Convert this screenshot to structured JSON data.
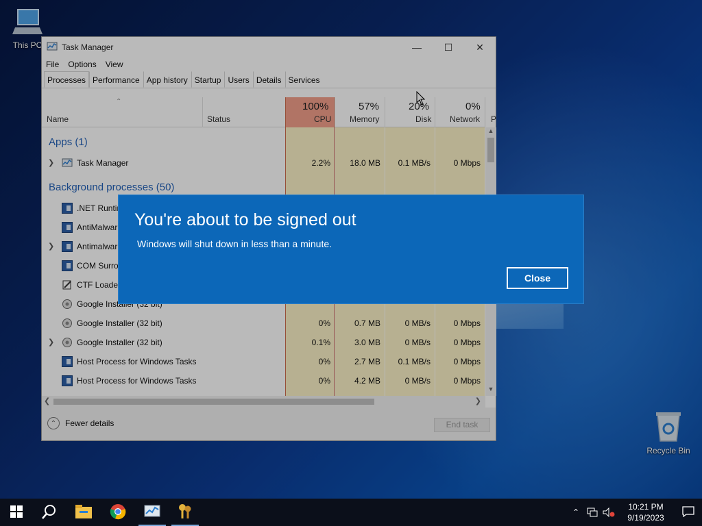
{
  "desktop": {
    "icons": [
      {
        "label": "This PC",
        "icon": "computer-icon"
      },
      {
        "label": "Recycle Bin",
        "icon": "recycle-bin-icon"
      }
    ]
  },
  "task_manager": {
    "title": "Task Manager",
    "menu": [
      "File",
      "Options",
      "View"
    ],
    "tabs": [
      "Processes",
      "Performance",
      "App history",
      "Startup",
      "Users",
      "Details",
      "Services"
    ],
    "active_tab": "Processes",
    "columns": {
      "name": "Name",
      "status": "Status",
      "cpu": {
        "pct": "100%",
        "label": "CPU"
      },
      "memory": {
        "pct": "57%",
        "label": "Memory"
      },
      "disk": {
        "pct": "20%",
        "label": "Disk"
      },
      "network": {
        "pct": "0%",
        "label": "Network"
      },
      "more": "P"
    },
    "groups": {
      "apps": "Apps (1)",
      "background": "Background processes (50)"
    },
    "rows": [
      {
        "name": "Task Manager",
        "expand": true,
        "cpu": "2.2%",
        "memory": "18.0 MB",
        "disk": "0.1 MB/s",
        "network": "0 Mbps"
      },
      {
        "name": ".NET Runtim",
        "expand": false,
        "cpu": "",
        "memory": "",
        "disk": "",
        "network": ""
      },
      {
        "name": "AntiMalwar",
        "expand": false,
        "cpu": "",
        "memory": "",
        "disk": "",
        "network": ""
      },
      {
        "name": "Antimalwar",
        "expand": true,
        "cpu": "",
        "memory": "",
        "disk": "",
        "network": ""
      },
      {
        "name": "COM Surroc",
        "expand": false,
        "cpu": "",
        "memory": "",
        "disk": "",
        "network": ""
      },
      {
        "name": "CTF Loader",
        "expand": false,
        "cpu": "",
        "memory": "",
        "disk": "",
        "network": ""
      },
      {
        "name": "Google Installer (32 bit)",
        "expand": false,
        "cpu": "",
        "memory": "",
        "disk": "",
        "network": ""
      },
      {
        "name": "Google Installer (32 bit)",
        "expand": false,
        "cpu": "0%",
        "memory": "0.7 MB",
        "disk": "0 MB/s",
        "network": "0 Mbps"
      },
      {
        "name": "Google Installer (32 bit)",
        "expand": true,
        "cpu": "0.1%",
        "memory": "3.0 MB",
        "disk": "0 MB/s",
        "network": "0 Mbps"
      },
      {
        "name": "Host Process for Windows Tasks",
        "expand": false,
        "cpu": "0%",
        "memory": "2.7 MB",
        "disk": "0.1 MB/s",
        "network": "0 Mbps"
      },
      {
        "name": "Host Process for Windows Tasks",
        "expand": false,
        "cpu": "0%",
        "memory": "4.2 MB",
        "disk": "0 MB/s",
        "network": "0 Mbps"
      }
    ],
    "footer": {
      "fewer_details": "Fewer details",
      "end_task": "End task"
    }
  },
  "dialog": {
    "title": "You're about to be signed out",
    "message": "Windows will shut down in less than a minute.",
    "close_label": "Close"
  },
  "taskbar": {
    "apps": [
      "start-icon",
      "search-icon",
      "file-explorer-icon",
      "chrome-icon",
      "task-manager-icon",
      "keys-app-icon"
    ],
    "time": "10:21 PM",
    "date": "9/19/2023"
  },
  "colors": {
    "dialog_bg": "#0c67b8",
    "cpu_header": "#f3a08b",
    "usage_fill": "#fbf2c7",
    "group_text": "#2462b8"
  }
}
